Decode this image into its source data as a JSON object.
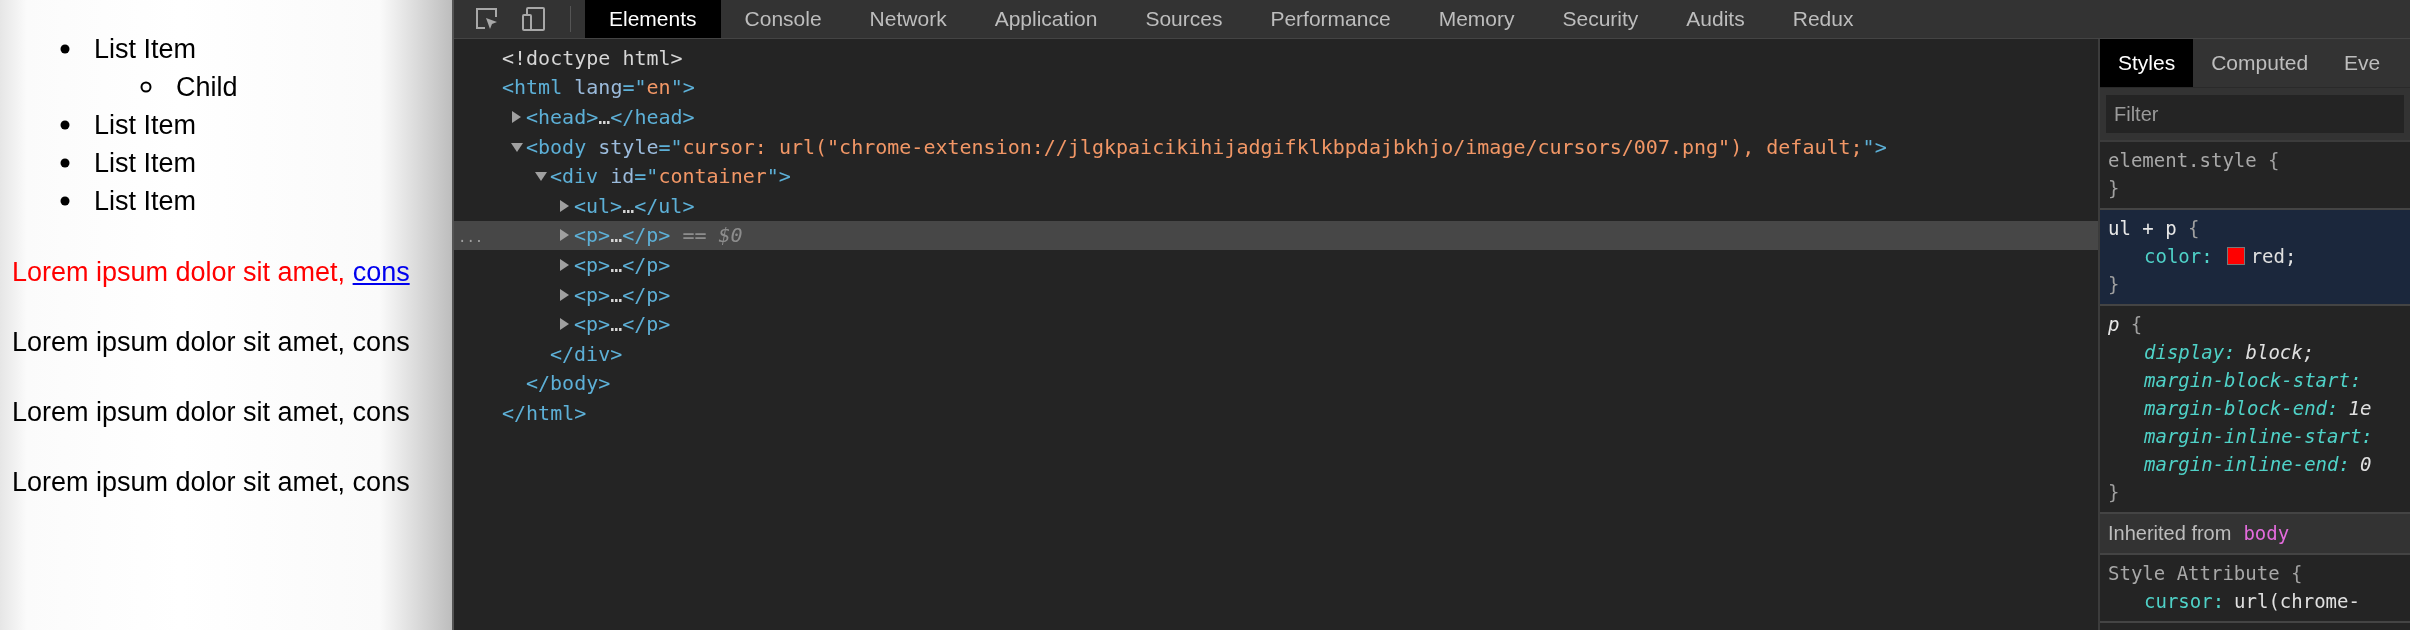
{
  "page": {
    "list": [
      {
        "text": "List Item",
        "children": [
          {
            "text": "Child"
          }
        ]
      },
      {
        "text": "List Item"
      },
      {
        "text": "List Item"
      },
      {
        "text": "List Item"
      }
    ],
    "paragraphs": [
      {
        "text": "Lorem ipsum dolor sit amet, ",
        "link": "cons",
        "color": "#ff0000"
      },
      {
        "text": "Lorem ipsum dolor sit amet, cons",
        "color": "#000000"
      },
      {
        "text": "Lorem ipsum dolor sit amet, cons",
        "color": "#000000"
      },
      {
        "text": "Lorem ipsum dolor sit amet, cons",
        "color": "#000000"
      }
    ]
  },
  "devtools": {
    "tabs": [
      {
        "label": "Elements",
        "selected": true
      },
      {
        "label": "Console",
        "selected": false
      },
      {
        "label": "Network",
        "selected": false
      },
      {
        "label": "Application",
        "selected": false
      },
      {
        "label": "Sources",
        "selected": false
      },
      {
        "label": "Performance",
        "selected": false
      },
      {
        "label": "Memory",
        "selected": false
      },
      {
        "label": "Security",
        "selected": false
      },
      {
        "label": "Audits",
        "selected": false
      },
      {
        "label": "Redux",
        "selected": false
      }
    ],
    "dom_tree": [
      {
        "selected": false,
        "tokens": [
          {
            "kind": "text",
            "text": "<!doctype html>"
          }
        ]
      },
      {
        "selected": false,
        "tokens": [
          {
            "kind": "tag",
            "text": "<html"
          },
          {
            "kind": "attr",
            "text": " lang"
          },
          {
            "kind": "tag",
            "text": "=\""
          },
          {
            "kind": "value",
            "text": "en"
          },
          {
            "kind": "tag",
            "text": "\">"
          }
        ],
        "closing": [
          {
            "kind": "tag",
            "text": "</html>"
          }
        ],
        "children": [
          {
            "selected": false,
            "expanded": false,
            "tokens": [
              {
                "kind": "tag",
                "text": "<head>"
              },
              {
                "kind": "text",
                "text": "…"
              },
              {
                "kind": "tag",
                "text": "</head>"
              }
            ]
          },
          {
            "selected": false,
            "expanded": true,
            "tokens": [
              {
                "kind": "tag",
                "text": "<body"
              },
              {
                "kind": "attr",
                "text": " style"
              },
              {
                "kind": "tag",
                "text": "=\""
              },
              {
                "kind": "value",
                "text": "cursor: url(\"chrome-extension://jlgkpaicikihijadgifklkbpdajbkhjo/image/cursors/007.png\"), default;"
              },
              {
                "kind": "tag",
                "text": "\">"
              }
            ],
            "closing": [
              {
                "kind": "tag",
                "text": "</body>"
              }
            ],
            "children": [
              {
                "selected": false,
                "expanded": true,
                "tokens": [
                  {
                    "kind": "tag",
                    "text": "<div"
                  },
                  {
                    "kind": "attr",
                    "text": " id"
                  },
                  {
                    "kind": "tag",
                    "text": "=\""
                  },
                  {
                    "kind": "value",
                    "text": "container"
                  },
                  {
                    "kind": "tag",
                    "text": "\">"
                  }
                ],
                "closing": [
                  {
                    "kind": "tag",
                    "text": "</div>"
                  }
                ],
                "children": [
                  {
                    "selected": false,
                    "expanded": false,
                    "tokens": [
                      {
                        "kind": "tag",
                        "text": "<ul>"
                      },
                      {
                        "kind": "text",
                        "text": "…"
                      },
                      {
                        "kind": "tag",
                        "text": "</ul>"
                      }
                    ]
                  },
                  {
                    "selected": true,
                    "gutter": "...",
                    "expanded": false,
                    "tokens": [
                      {
                        "kind": "tag",
                        "text": "<p>"
                      },
                      {
                        "kind": "text",
                        "text": "…"
                      },
                      {
                        "kind": "tag",
                        "text": "</p>"
                      },
                      {
                        "kind": "hint",
                        "text": " == $0"
                      }
                    ]
                  },
                  {
                    "selected": false,
                    "expanded": false,
                    "tokens": [
                      {
                        "kind": "tag",
                        "text": "<p>"
                      },
                      {
                        "kind": "text",
                        "text": "…"
                      },
                      {
                        "kind": "tag",
                        "text": "</p>"
                      }
                    ]
                  },
                  {
                    "selected": false,
                    "expanded": false,
                    "tokens": [
                      {
                        "kind": "tag",
                        "text": "<p>"
                      },
                      {
                        "kind": "text",
                        "text": "…"
                      },
                      {
                        "kind": "tag",
                        "text": "</p>"
                      }
                    ]
                  },
                  {
                    "selected": false,
                    "expanded": false,
                    "tokens": [
                      {
                        "kind": "tag",
                        "text": "<p>"
                      },
                      {
                        "kind": "text",
                        "text": "…"
                      },
                      {
                        "kind": "tag",
                        "text": "</p>"
                      }
                    ]
                  }
                ]
              }
            ]
          }
        ]
      }
    ],
    "sidebar": {
      "tabs": [
        {
          "label": "Styles",
          "selected": true
        },
        {
          "label": "Computed",
          "selected": false
        },
        {
          "label": "Eve",
          "selected": false
        }
      ],
      "filter": {
        "placeholder": "Filter"
      },
      "sections": [
        {
          "kind": "inline",
          "highlighted": false,
          "selector": "element.style",
          "open": "{",
          "closing": "}"
        },
        {
          "kind": "author",
          "highlighted": true,
          "selector": "ul + p",
          "open": "{",
          "properties": [
            {
              "name": "color:",
              "value": "red;",
              "color": "#ff0000"
            }
          ],
          "closing": "}"
        },
        {
          "kind": "useragent",
          "highlighted": false,
          "selector": "p",
          "open": "{",
          "properties": [
            {
              "name": "display:",
              "value": "block;"
            },
            {
              "name": "margin-block-start:"
            },
            {
              "name": "margin-block-end:",
              "value": "1e"
            },
            {
              "name": "margin-inline-start:"
            },
            {
              "name": "margin-inline-end:",
              "value": "0"
            }
          ],
          "closing": "}"
        },
        {
          "kind": "header",
          "label": "Inherited from",
          "element": "body"
        },
        {
          "kind": "inline",
          "highlighted": false,
          "selector": "Style Attribute",
          "open": "{",
          "properties": [
            {
              "name": "cursor:",
              "value": "url(chrome-"
            }
          ]
        }
      ]
    }
  }
}
